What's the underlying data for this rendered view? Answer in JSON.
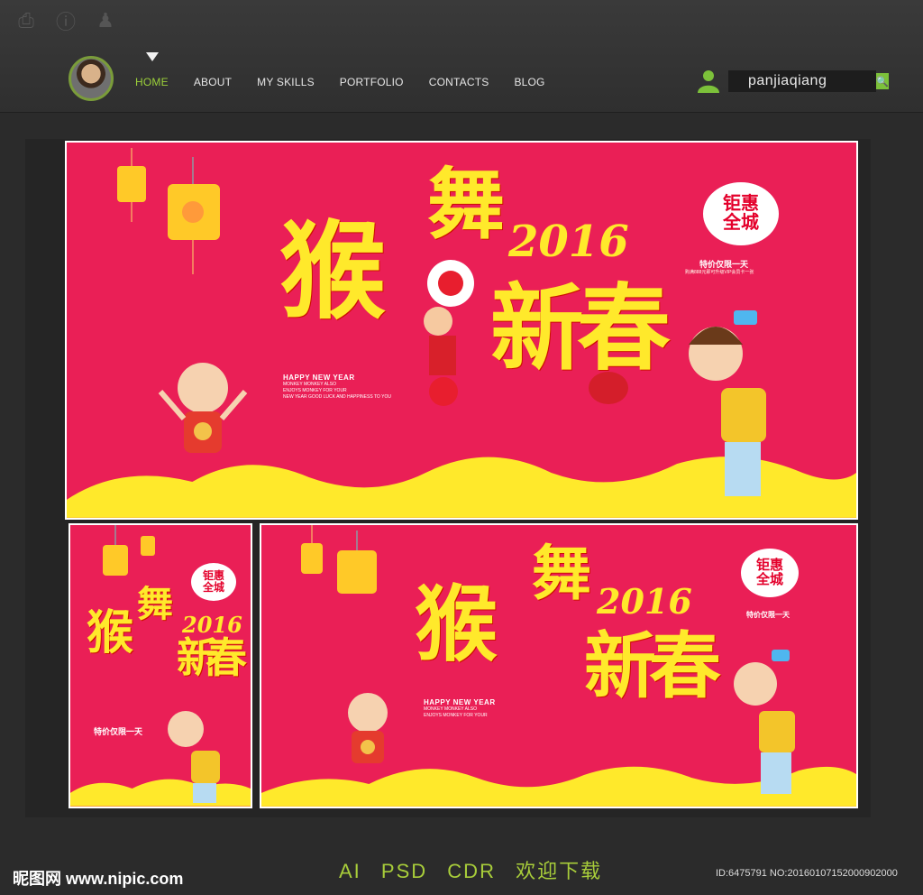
{
  "nav": {
    "items": [
      "HOME",
      "ABOUT",
      "MY SKILLS",
      "PORTFOLIO",
      "CONTACTS",
      "BLOG"
    ],
    "active": "HOME"
  },
  "search": {
    "value": "panjiaqiang"
  },
  "icons": {
    "top": [
      "printer-icon",
      "info-icon",
      "group-icon"
    ],
    "user": "user-icon",
    "search": "search-icon"
  },
  "banner": {
    "title_chars": [
      "猴",
      "舞",
      "新",
      "春"
    ],
    "year": "2016",
    "bubble": "钜惠\n全城",
    "promo": "特价仅限一天",
    "promo_small": "购满888元即可升级VIP会员卡一张",
    "hny_title": "HAPPY NEW YEAR",
    "hny_lines": [
      "MONKEY MONKEY ALSO",
      "ENJOYS MONKEY FOR YOUR",
      "NEW YEAR GOOD LUCK AND HAPPINESS TO YOU"
    ]
  },
  "footer": {
    "formats": [
      "AI",
      "PSD",
      "CDR",
      "欢迎下载"
    ],
    "watermark": "昵图网 www.nipic.com",
    "id": "ID:6475791 NO:20160107152000902000"
  },
  "colors": {
    "banner_red": "#ea1f56",
    "yellow": "#ffe92b",
    "accent_green": "#9cd13a"
  }
}
